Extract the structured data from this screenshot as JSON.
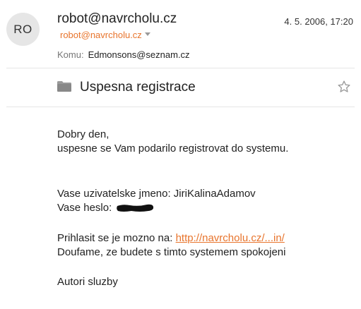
{
  "header": {
    "avatar_initials": "RO",
    "sender_name": "robot@navrcholu.cz",
    "sender_address": "robot@navrcholu.cz",
    "date": "4. 5. 2006, 17:20",
    "to_label": "Komu:",
    "to_value": "Edmonsons@seznam.cz"
  },
  "subject": {
    "text": "Uspesna registrace",
    "folder_icon": "folder-icon",
    "star_icon": "star-icon"
  },
  "body": {
    "greeting": "Dobry den,",
    "line1": "uspesne se Vam podarilo registrovat do systemu.",
    "username_line": "Vase uzivatelske jmeno: JiriKalinaAdamov",
    "password_label": "Vase heslo:",
    "login_prefix": "Prihlasit se je mozno na:",
    "login_link": "http://navrcholu.cz/...in/",
    "hope_line": "Doufame, ze budete s timto systemem spokojeni",
    "signature": "Autori sluzby"
  },
  "colors": {
    "accent": "#e8742c",
    "avatar_bg": "#e6e6e6",
    "divider": "#e5e5e5",
    "redaction": "#111111"
  }
}
